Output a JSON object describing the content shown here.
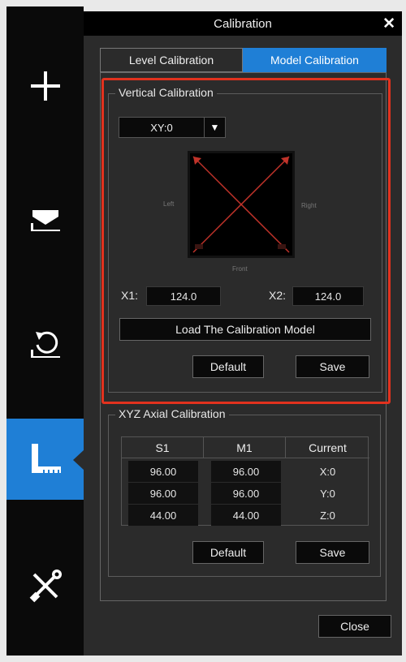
{
  "sidebar": {
    "items": [
      {
        "name": "add-model",
        "icon": "plus-icon"
      },
      {
        "name": "lay-flat",
        "icon": "lay-flat-icon"
      },
      {
        "name": "rotate",
        "icon": "rotate-icon"
      },
      {
        "name": "calibration",
        "icon": "ruler-icon",
        "active": true
      },
      {
        "name": "tools",
        "icon": "tools-icon"
      }
    ],
    "accent": "#1f7fd6"
  },
  "dialog": {
    "title": "Calibration",
    "close_glyph": "✕",
    "tabs": [
      {
        "label": "Level Calibration",
        "active": false
      },
      {
        "label": "Model Calibration",
        "active": true
      }
    ],
    "highlight_color": "#e2321e"
  },
  "vertical": {
    "title": "Vertical Calibration",
    "axis_select": "XY:0",
    "diagram": {
      "left": "Left",
      "right": "Right",
      "front": "Front"
    },
    "x1_label": "X1:",
    "x1_value": "124.0",
    "x2_label": "X2:",
    "x2_value": "124.0",
    "load_button": "Load The Calibration Model",
    "default_button": "Default",
    "save_button": "Save"
  },
  "axial": {
    "title": "XYZ Axial Calibration",
    "headers": [
      "S1",
      "M1",
      "Current"
    ],
    "rows": [
      {
        "s1": "96.00",
        "m1": "96.00",
        "current": "X:0"
      },
      {
        "s1": "96.00",
        "m1": "96.00",
        "current": "Y:0"
      },
      {
        "s1": "44.00",
        "m1": "44.00",
        "current": "Z:0"
      }
    ],
    "default_button": "Default",
    "save_button": "Save"
  },
  "footer": {
    "close_button": "Close"
  }
}
